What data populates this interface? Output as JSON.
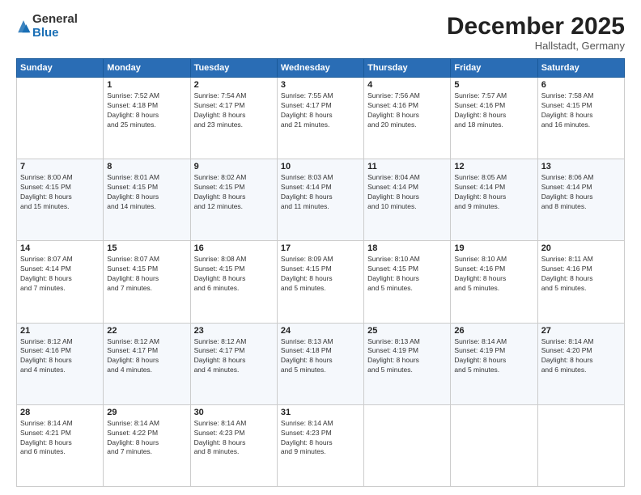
{
  "logo": {
    "general": "General",
    "blue": "Blue"
  },
  "header": {
    "month": "December 2025",
    "location": "Hallstadt, Germany"
  },
  "days_of_week": [
    "Sunday",
    "Monday",
    "Tuesday",
    "Wednesday",
    "Thursday",
    "Friday",
    "Saturday"
  ],
  "weeks": [
    [
      {
        "day": "",
        "info": ""
      },
      {
        "day": "1",
        "info": "Sunrise: 7:52 AM\nSunset: 4:18 PM\nDaylight: 8 hours\nand 25 minutes."
      },
      {
        "day": "2",
        "info": "Sunrise: 7:54 AM\nSunset: 4:17 PM\nDaylight: 8 hours\nand 23 minutes."
      },
      {
        "day": "3",
        "info": "Sunrise: 7:55 AM\nSunset: 4:17 PM\nDaylight: 8 hours\nand 21 minutes."
      },
      {
        "day": "4",
        "info": "Sunrise: 7:56 AM\nSunset: 4:16 PM\nDaylight: 8 hours\nand 20 minutes."
      },
      {
        "day": "5",
        "info": "Sunrise: 7:57 AM\nSunset: 4:16 PM\nDaylight: 8 hours\nand 18 minutes."
      },
      {
        "day": "6",
        "info": "Sunrise: 7:58 AM\nSunset: 4:15 PM\nDaylight: 8 hours\nand 16 minutes."
      }
    ],
    [
      {
        "day": "7",
        "info": "Sunrise: 8:00 AM\nSunset: 4:15 PM\nDaylight: 8 hours\nand 15 minutes."
      },
      {
        "day": "8",
        "info": "Sunrise: 8:01 AM\nSunset: 4:15 PM\nDaylight: 8 hours\nand 14 minutes."
      },
      {
        "day": "9",
        "info": "Sunrise: 8:02 AM\nSunset: 4:15 PM\nDaylight: 8 hours\nand 12 minutes."
      },
      {
        "day": "10",
        "info": "Sunrise: 8:03 AM\nSunset: 4:14 PM\nDaylight: 8 hours\nand 11 minutes."
      },
      {
        "day": "11",
        "info": "Sunrise: 8:04 AM\nSunset: 4:14 PM\nDaylight: 8 hours\nand 10 minutes."
      },
      {
        "day": "12",
        "info": "Sunrise: 8:05 AM\nSunset: 4:14 PM\nDaylight: 8 hours\nand 9 minutes."
      },
      {
        "day": "13",
        "info": "Sunrise: 8:06 AM\nSunset: 4:14 PM\nDaylight: 8 hours\nand 8 minutes."
      }
    ],
    [
      {
        "day": "14",
        "info": "Sunrise: 8:07 AM\nSunset: 4:14 PM\nDaylight: 8 hours\nand 7 minutes."
      },
      {
        "day": "15",
        "info": "Sunrise: 8:07 AM\nSunset: 4:15 PM\nDaylight: 8 hours\nand 7 minutes."
      },
      {
        "day": "16",
        "info": "Sunrise: 8:08 AM\nSunset: 4:15 PM\nDaylight: 8 hours\nand 6 minutes."
      },
      {
        "day": "17",
        "info": "Sunrise: 8:09 AM\nSunset: 4:15 PM\nDaylight: 8 hours\nand 5 minutes."
      },
      {
        "day": "18",
        "info": "Sunrise: 8:10 AM\nSunset: 4:15 PM\nDaylight: 8 hours\nand 5 minutes."
      },
      {
        "day": "19",
        "info": "Sunrise: 8:10 AM\nSunset: 4:16 PM\nDaylight: 8 hours\nand 5 minutes."
      },
      {
        "day": "20",
        "info": "Sunrise: 8:11 AM\nSunset: 4:16 PM\nDaylight: 8 hours\nand 5 minutes."
      }
    ],
    [
      {
        "day": "21",
        "info": "Sunrise: 8:12 AM\nSunset: 4:16 PM\nDaylight: 8 hours\nand 4 minutes."
      },
      {
        "day": "22",
        "info": "Sunrise: 8:12 AM\nSunset: 4:17 PM\nDaylight: 8 hours\nand 4 minutes."
      },
      {
        "day": "23",
        "info": "Sunrise: 8:12 AM\nSunset: 4:17 PM\nDaylight: 8 hours\nand 4 minutes."
      },
      {
        "day": "24",
        "info": "Sunrise: 8:13 AM\nSunset: 4:18 PM\nDaylight: 8 hours\nand 5 minutes."
      },
      {
        "day": "25",
        "info": "Sunrise: 8:13 AM\nSunset: 4:19 PM\nDaylight: 8 hours\nand 5 minutes."
      },
      {
        "day": "26",
        "info": "Sunrise: 8:14 AM\nSunset: 4:19 PM\nDaylight: 8 hours\nand 5 minutes."
      },
      {
        "day": "27",
        "info": "Sunrise: 8:14 AM\nSunset: 4:20 PM\nDaylight: 8 hours\nand 6 minutes."
      }
    ],
    [
      {
        "day": "28",
        "info": "Sunrise: 8:14 AM\nSunset: 4:21 PM\nDaylight: 8 hours\nand 6 minutes."
      },
      {
        "day": "29",
        "info": "Sunrise: 8:14 AM\nSunset: 4:22 PM\nDaylight: 8 hours\nand 7 minutes."
      },
      {
        "day": "30",
        "info": "Sunrise: 8:14 AM\nSunset: 4:23 PM\nDaylight: 8 hours\nand 8 minutes."
      },
      {
        "day": "31",
        "info": "Sunrise: 8:14 AM\nSunset: 4:23 PM\nDaylight: 8 hours\nand 9 minutes."
      },
      {
        "day": "",
        "info": ""
      },
      {
        "day": "",
        "info": ""
      },
      {
        "day": "",
        "info": ""
      }
    ]
  ]
}
